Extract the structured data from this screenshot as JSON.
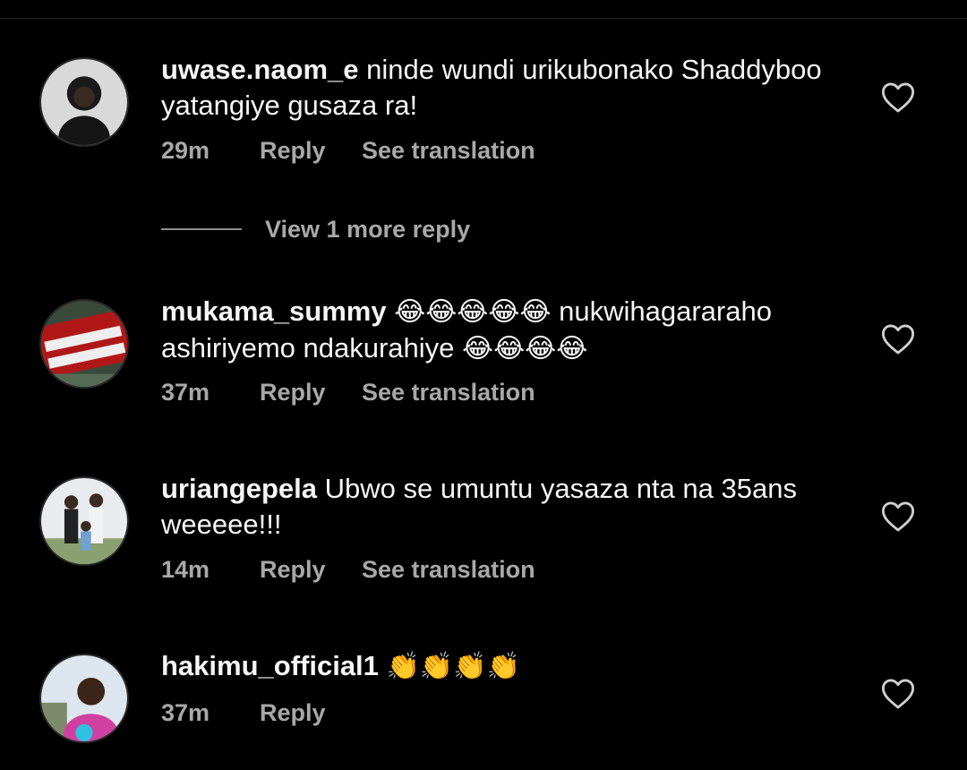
{
  "comments": [
    {
      "username": "uwase.naom_e",
      "text": "ninde wundi urikubonako Shaddyboo yatangiye gusaza ra!",
      "emoji": "",
      "text2": "",
      "emoji2": "",
      "time": "29m",
      "reply_label": "Reply",
      "translate_label": "See translation"
    },
    {
      "username": "mukama_summy",
      "text": "",
      "emoji": "😂😂😂😂😂",
      "text2": "nukwihagararaho ashiriyemo ndakurahiye",
      "emoji2": "😂😂😂😂",
      "time": "37m",
      "reply_label": "Reply",
      "translate_label": "See translation"
    },
    {
      "username": "uriangepela",
      "text": "Ubwo se umuntu yasaza nta na 35ans weeeee!!!",
      "emoji": "",
      "text2": "",
      "emoji2": "",
      "time": "14m",
      "reply_label": "Reply",
      "translate_label": "See translation"
    },
    {
      "username": "hakimu_official1",
      "text": "",
      "emoji": "👏👏👏👏",
      "text2": "",
      "emoji2": "",
      "time": "37m",
      "reply_label": "Reply",
      "translate_label": ""
    }
  ],
  "view_more_replies": "View 1 more reply",
  "icons": {
    "like": "heart-outline-icon",
    "avatar": "user-avatar"
  },
  "colors": {
    "background": "#000000",
    "text": "#f5f5f5",
    "secondary": "#a8a8a8"
  }
}
